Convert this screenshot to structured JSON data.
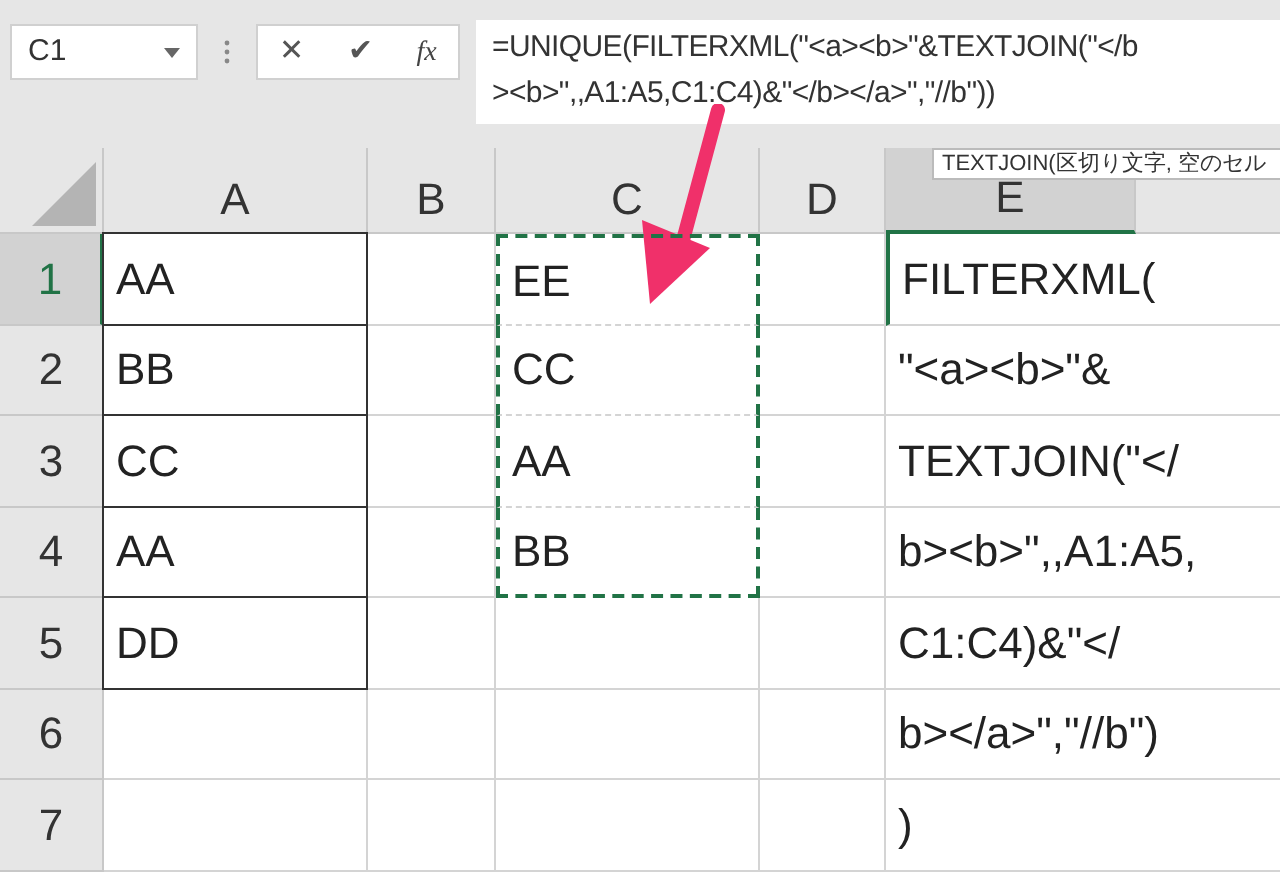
{
  "name_box": {
    "value": "C1"
  },
  "formula_buttons": [
    "✕",
    "✔",
    "fx"
  ],
  "formula": "=UNIQUE(FILTERXML(\"<a><b>\"&TEXTJOIN(\"</b><b>\",,A1:A5,C1:C4)&\"</b></a>\",\"//b\"))",
  "tooltip": "TEXTJOIN(区切り文字, 空のセル",
  "columns": [
    {
      "label": "A",
      "selected": false
    },
    {
      "label": "B",
      "selected": false
    },
    {
      "label": "C",
      "selected": false
    },
    {
      "label": "D",
      "selected": false
    },
    {
      "label": "E",
      "selected": true
    }
  ],
  "rows": [
    {
      "label": "1",
      "selected": true,
      "cells": [
        {
          "kind": "boxed",
          "text": "AA"
        },
        {
          "kind": "plain"
        },
        {
          "kind": "copy",
          "text": "EE"
        },
        {
          "kind": "plain"
        },
        {
          "kind": "active",
          "text": "FILTERXML("
        }
      ]
    },
    {
      "label": "2",
      "selected": false,
      "cells": [
        {
          "kind": "boxed",
          "text": "BB"
        },
        {
          "kind": "plain"
        },
        {
          "kind": "copy",
          "text": "CC"
        },
        {
          "kind": "plain"
        },
        {
          "kind": "plain",
          "text": "\"<a><b>\"&"
        }
      ]
    },
    {
      "label": "3",
      "selected": false,
      "cells": [
        {
          "kind": "boxed",
          "text": "CC"
        },
        {
          "kind": "plain"
        },
        {
          "kind": "copy",
          "text": "AA"
        },
        {
          "kind": "plain"
        },
        {
          "kind": "plain",
          "text": "TEXTJOIN(\"</"
        }
      ]
    },
    {
      "label": "4",
      "selected": false,
      "cells": [
        {
          "kind": "boxed",
          "text": "AA"
        },
        {
          "kind": "plain"
        },
        {
          "kind": "copy",
          "text": "BB"
        },
        {
          "kind": "plain"
        },
        {
          "kind": "plain",
          "text": "b><b>\",,A1:A5,"
        }
      ]
    },
    {
      "label": "5",
      "selected": false,
      "cells": [
        {
          "kind": "boxed",
          "text": "DD"
        },
        {
          "kind": "plain"
        },
        {
          "kind": "plain"
        },
        {
          "kind": "plain"
        },
        {
          "kind": "plain",
          "text": "C1:C4)&\"</"
        }
      ]
    },
    {
      "label": "6",
      "selected": false,
      "cells": [
        {
          "kind": "plain"
        },
        {
          "kind": "plain"
        },
        {
          "kind": "plain"
        },
        {
          "kind": "plain"
        },
        {
          "kind": "plain",
          "text": "b></a>\",\"//b\")"
        }
      ]
    },
    {
      "label": "7",
      "selected": false,
      "cells": [
        {
          "kind": "plain"
        },
        {
          "kind": "plain"
        },
        {
          "kind": "plain"
        },
        {
          "kind": "plain"
        },
        {
          "kind": "plain",
          "text": ")"
        }
      ]
    }
  ]
}
